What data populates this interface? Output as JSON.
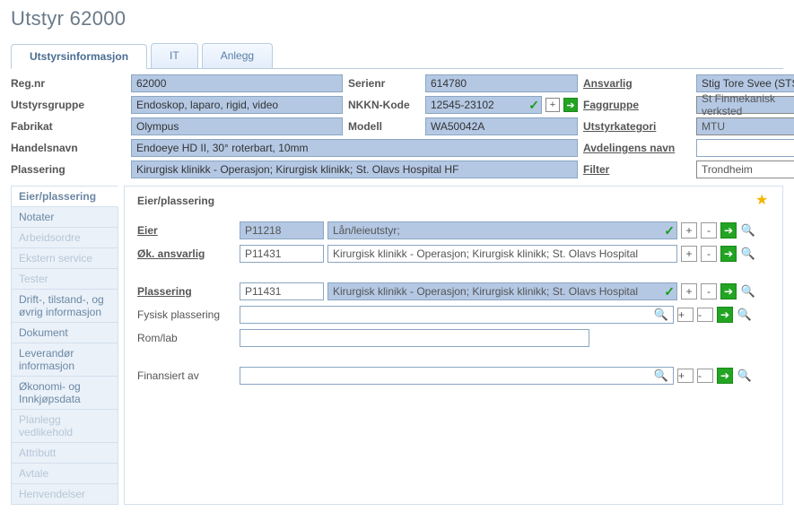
{
  "title": "Utstyr 62000",
  "tabs": [
    {
      "label": "Utstyrsinformasjon",
      "active": true
    },
    {
      "label": "IT",
      "active": false
    },
    {
      "label": "Anlegg",
      "active": false
    }
  ],
  "topform": {
    "regnr_label": "Reg.nr",
    "regnr": "62000",
    "serienr_label": "Serienr",
    "serienr": "614780",
    "ansvarlig_label": "Ansvarlig",
    "ansvarlig": "Stig Tore Svee (STS)",
    "utstyrsgruppe_label": "Utstyrsgruppe",
    "utstyrsgruppe": "Endoskop, laparo, rigid, video",
    "nkkn_label": "NKKN-Kode",
    "nkkn": "12545-23102",
    "faggruppe_label": "Faggruppe",
    "faggruppe": "St Finmekanisk verksted",
    "fabrikat_label": "Fabrikat",
    "fabrikat": "Olympus",
    "modell_label": "Modell",
    "modell": "WA50042A",
    "utstyrkategori_label": "Utstyrkategori",
    "utstyrkategori": "MTU",
    "handelsnavn_label": "Handelsnavn",
    "handelsnavn": "Endoeye HD II, 30° roterbart, 10mm",
    "avdelingens_label": "Avdelingens navn",
    "avdelingens": "",
    "plassering_label": "Plassering",
    "plassering": "Kirurgisk klinikk - Operasjon; Kirurgisk klinikk; St. Olavs Hospital HF",
    "filter_label": "Filter",
    "filter": "Trondheim"
  },
  "sidebar": [
    {
      "label": "Eier/plassering",
      "active": true
    },
    {
      "label": "Notater"
    },
    {
      "label": "Arbeidsordre",
      "disabled": true
    },
    {
      "label": "Ekstern service",
      "disabled": true
    },
    {
      "label": "Tester",
      "disabled": true
    },
    {
      "label": "Drift-, tilstand-, og øvrig informasjon"
    },
    {
      "label": "Dokument"
    },
    {
      "label": "Leverandør informasjon"
    },
    {
      "label": "Økonomi- og Innkjøpsdata"
    },
    {
      "label": "Planlegg vedlikehold",
      "disabled": true
    },
    {
      "label": "Attributt",
      "disabled": true
    },
    {
      "label": "Avtale",
      "disabled": true
    },
    {
      "label": "Henvendelser",
      "disabled": true
    }
  ],
  "panel": {
    "title": "Eier/plassering",
    "eier_label": "Eier",
    "eier_id": "P11218",
    "eier_desc": "Lån/leieutstyr;",
    "ok_label": "Øk. ansvarlig",
    "ok_id": "P11431",
    "ok_desc": "Kirurgisk klinikk - Operasjon; Kirurgisk klinikk; St. Olavs Hospital",
    "plassering_label": "Plassering",
    "plassering_id": "P11431",
    "plassering_desc": "Kirurgisk klinikk - Operasjon; Kirurgisk klinikk; St. Olavs Hospital",
    "fysisk_label": "Fysisk plassering",
    "fysisk_value": "",
    "romlab_label": "Rom/lab",
    "romlab_value": "",
    "finans_label": "Finansiert av",
    "finans_value": ""
  }
}
